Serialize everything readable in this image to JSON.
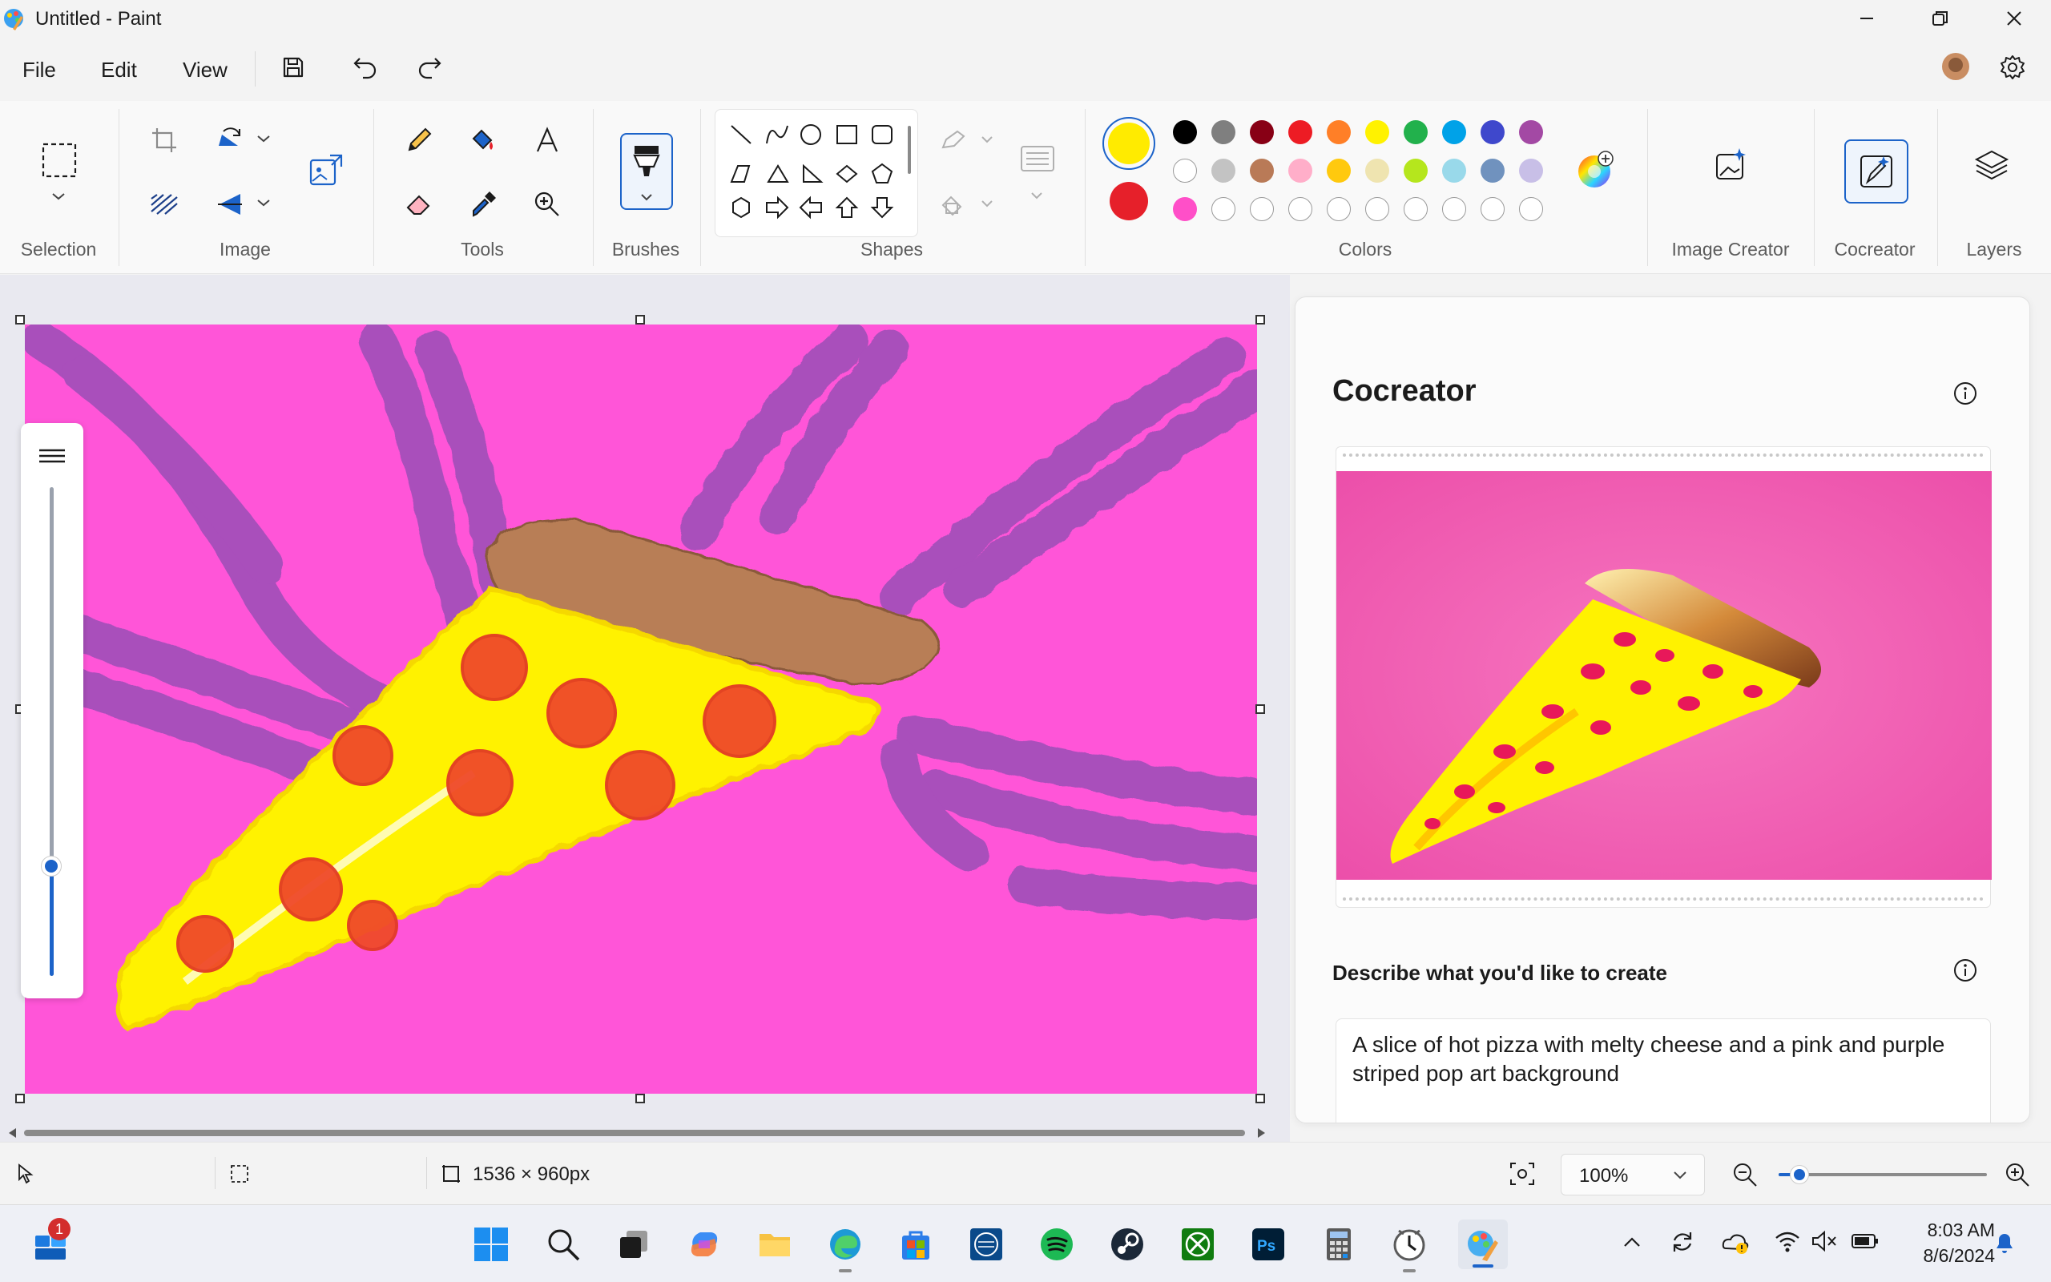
{
  "window": {
    "title": "Untitled - Paint"
  },
  "menu": {
    "file": "File",
    "edit": "Edit",
    "view": "View"
  },
  "ribbon": {
    "groups": {
      "selection": "Selection",
      "image": "Image",
      "tools": "Tools",
      "brushes": "Brushes",
      "shapes": "Shapes",
      "colors": "Colors",
      "image_creator": "Image Creator",
      "cocreator": "Cocreator",
      "layers": "Layers"
    },
    "primary_color": "#FFEB00",
    "secondary_color": "#E6202A",
    "palette_row1": [
      "#000000",
      "#7F7F7F",
      "#880015",
      "#ED1C24",
      "#FF7F27",
      "#FFF200",
      "#22B14C",
      "#00A2E8",
      "#3F48CC",
      "#A349A4"
    ],
    "palette_row2": [
      "#FFFFFF",
      "#C3C3C3",
      "#B97A57",
      "#FFAEC9",
      "#FFC90E",
      "#EFE4B0",
      "#B5E61D",
      "#99D9EA",
      "#7092BE",
      "#C8BFE7"
    ],
    "palette_row3": [
      "#FF4FC8",
      "",
      "",
      "",
      "",
      "",
      "",
      "",
      "",
      ""
    ]
  },
  "canvas": {
    "background": "#FF55D8",
    "stripe_color": "#A04FB8"
  },
  "cocreator": {
    "title": "Cocreator",
    "describe_label": "Describe what you'd like to create",
    "prompt": "A slice of hot pizza with melty cheese and a pink and purple striped pop art background"
  },
  "status": {
    "dimensions": "1536 × 960px",
    "zoom": "100%",
    "zoom_level": 0.06
  },
  "taskbar": {
    "badge_count": "1",
    "time": "8:03 AM",
    "date": "8/6/2024"
  }
}
